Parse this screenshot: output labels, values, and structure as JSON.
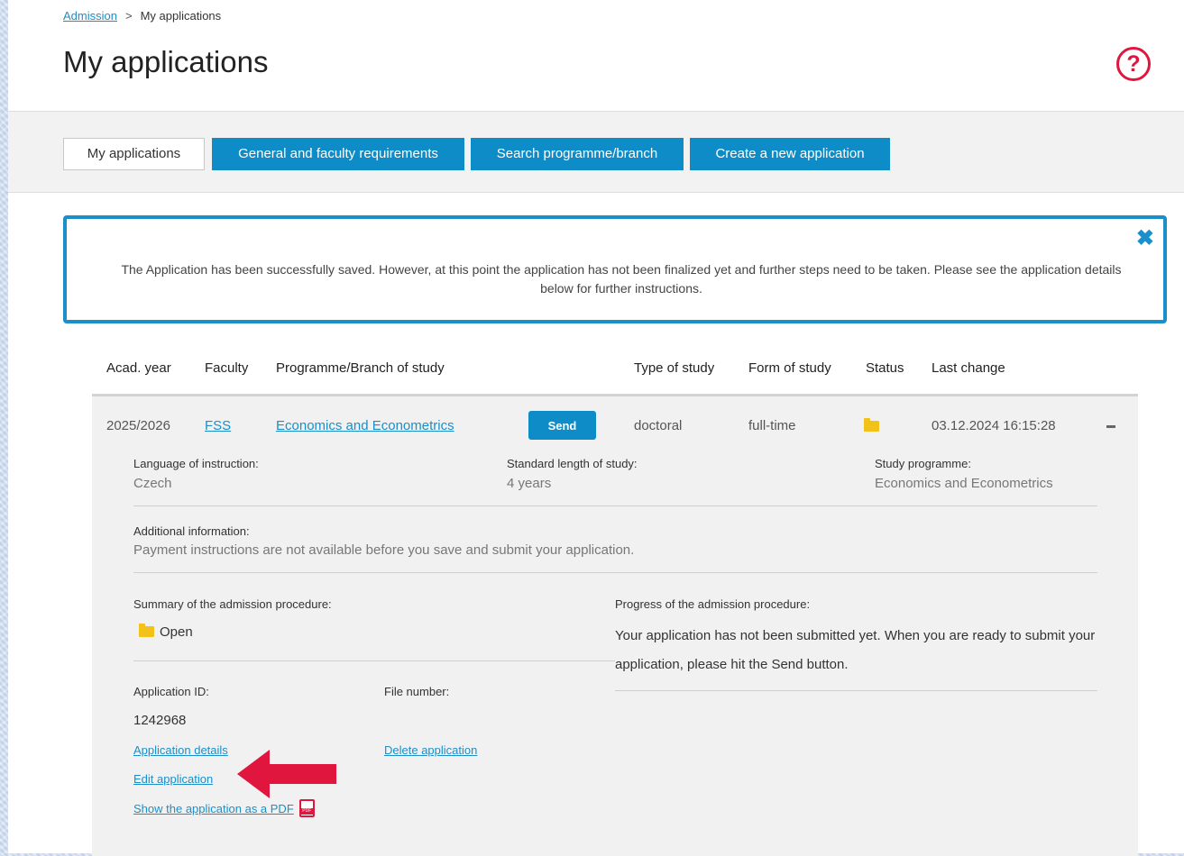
{
  "breadcrumb": {
    "root": "Admission",
    "separator": ">",
    "current": "My applications"
  },
  "page": {
    "title": "My applications",
    "help_icon": "question-circle-icon"
  },
  "tabs": [
    {
      "label": "My applications",
      "active": true
    },
    {
      "label": "General and faculty requirements",
      "active": false
    },
    {
      "label": "Search programme/branch",
      "active": false
    },
    {
      "label": "Create a new application",
      "active": false
    }
  ],
  "alert": {
    "text": "The Application has been successfully saved. However, at this point the application has not been finalized yet and further steps need to be taken. Please see the application details below for further instructions.",
    "close_icon": "close-x-icon"
  },
  "table": {
    "headers": [
      "Acad. year",
      "Faculty",
      "Programme/Branch of study",
      "Type of study",
      "Form of study",
      "Status",
      "Last change"
    ],
    "row": {
      "acad_year": "2025/2026",
      "faculty": "FSS",
      "programme": "Economics and Econometrics",
      "send_label": "Send",
      "type": "doctoral",
      "form": "full-time",
      "status_icon": "folder-icon",
      "last_change": "03.12.2024 16:15:28",
      "collapse_icon": "minus-icon"
    }
  },
  "details": {
    "language_label": "Language of instruction:",
    "language_value": "Czech",
    "length_label": "Standard length of study:",
    "length_value": "4 years",
    "programme_label": "Study programme:",
    "programme_value": "Economics and Econometrics",
    "additional_label": "Additional information:",
    "additional_value": "Payment instructions are not available before you save and submit your application.",
    "summary_label": "Summary of the admission procedure:",
    "summary_value": "Open",
    "progress_label": "Progress of the admission procedure:",
    "progress_value": "Your application has not been submitted yet. When you are ready to submit your application, please hit the Send button.",
    "app_id_label": "Application ID:",
    "app_id_value": "1242968",
    "file_number_label": "File number:",
    "links": {
      "details": "Application details",
      "delete": "Delete application",
      "edit": "Edit application",
      "pdf": "Show the application as a PDF"
    },
    "pdf_icon": "pdf-file-icon",
    "annotation_arrow": "red-arrow-icon",
    "colors": {
      "accent": "#0d8cc7",
      "link": "#1a8fc9",
      "highlight": "#e0163f",
      "folder": "#f2c21a"
    }
  }
}
